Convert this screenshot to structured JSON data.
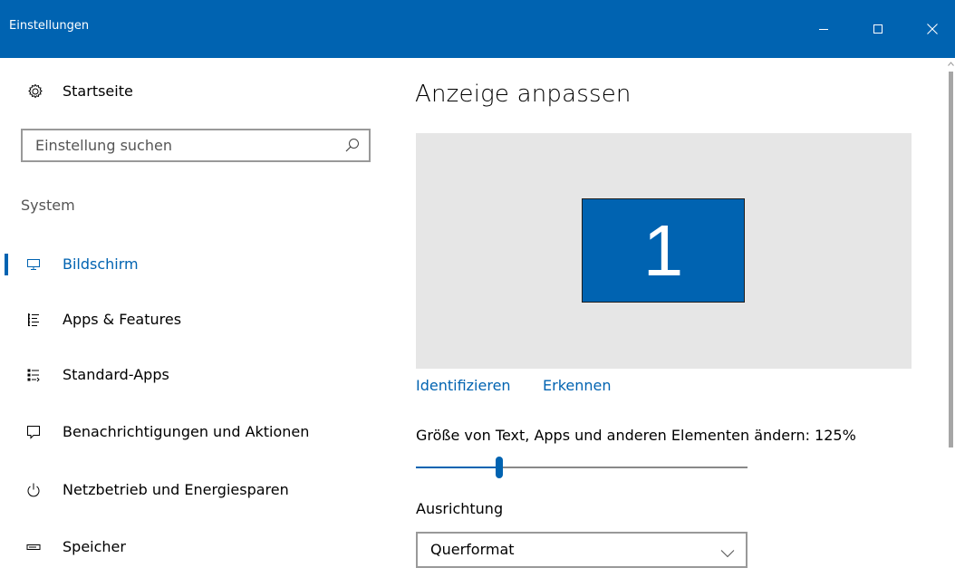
{
  "window": {
    "title": "Einstellungen",
    "controls": {
      "minimize": "minimize-icon",
      "maximize": "maximize-icon",
      "close": "close-icon"
    },
    "accent_color": "#0063b1"
  },
  "sidebar": {
    "home": {
      "label": "Startseite",
      "icon": "gear-icon"
    },
    "search": {
      "placeholder": "Einstellung suchen",
      "value": "",
      "icon": "search-icon"
    },
    "section": "System",
    "items": [
      {
        "label": "Bildschirm",
        "icon": "monitor-icon",
        "active": true
      },
      {
        "label": "Apps & Features",
        "icon": "list-icon",
        "active": false
      },
      {
        "label": "Standard-Apps",
        "icon": "default-apps-icon",
        "active": false
      },
      {
        "label": "Benachrichtigungen und Aktionen",
        "icon": "notification-icon",
        "active": false
      },
      {
        "label": "Netzbetrieb und Energiesparen",
        "icon": "power-icon",
        "active": false
      },
      {
        "label": "Speicher",
        "icon": "storage-icon",
        "active": false
      }
    ]
  },
  "main": {
    "title": "Anzeige anpassen",
    "display": {
      "number": "1",
      "color": "#0063b1",
      "background": "#e6e6e6"
    },
    "links": {
      "identify": "Identifizieren",
      "detect": "Erkennen"
    },
    "scale": {
      "label": "Größe von Text, Apps und anderen Elementen ändern: 125%",
      "slider_fraction": 0.25
    },
    "orientation": {
      "label": "Ausrichtung",
      "selected": "Querformat"
    }
  }
}
